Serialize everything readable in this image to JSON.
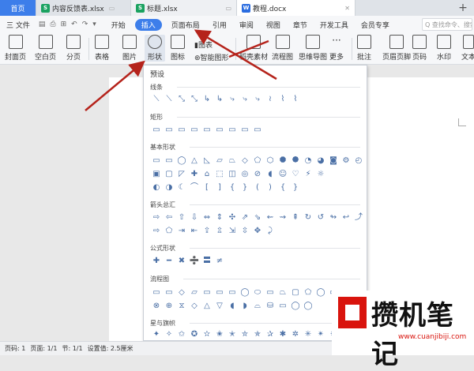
{
  "tabs": [
    {
      "label": "首页",
      "type": "home"
    },
    {
      "label": "内容反馈表.xlsx",
      "icon": "S",
      "icon_color": "#1aa260"
    },
    {
      "label": "标题.xlsx",
      "icon": "S",
      "icon_color": "#1aa260"
    },
    {
      "label": "教程.docx",
      "icon": "W",
      "icon_color": "#2b6de0"
    }
  ],
  "menu": {
    "file": "三 文件",
    "quick": [
      "▤",
      "⎙",
      "⊞",
      "↶",
      "↷",
      "▾"
    ],
    "items": [
      "开始",
      "插入",
      "页面布局",
      "引用",
      "审阅",
      "视图",
      "章节",
      "开发工具",
      "会员专享"
    ],
    "active": "插入",
    "search": "Q 查找命令、搜索"
  },
  "toolbar": {
    "cover": "封面页",
    "blank": "空白页",
    "pagebreak": "分页",
    "table": "表格",
    "picture": "图片",
    "shape": "形状",
    "icon": "图标",
    "chart": "图表",
    "smartart": "智能图形",
    "stock": "稻壳素材",
    "flowchart": "流程图",
    "mindmap": "思维导图",
    "more": "更多",
    "comment": "批注",
    "headerfooter": "页眉页脚",
    "pagenum": "页码",
    "watermark": "水印",
    "text": "文本"
  },
  "shapes_panel": {
    "title": "预设",
    "sections": [
      "线条",
      "矩形",
      "基本形状",
      "箭头总汇",
      "公式形状",
      "流程图",
      "星与旗帜"
    ],
    "lines": [
      "⟍",
      "⟍",
      "⤡",
      "⤡",
      "↳",
      "↳",
      "⤷",
      "⤷",
      "⤷",
      "≀",
      "⌇",
      "⌇"
    ],
    "rects": [
      "▭",
      "▭",
      "▭",
      "▭",
      "▭",
      "▭",
      "▭",
      "▭",
      "▭"
    ],
    "basic1": [
      "▭",
      "▭",
      "◯",
      "△",
      "◺",
      "▱",
      "⏢",
      "◇",
      "⬠",
      "⬡",
      "⯃",
      "⯄",
      "◔",
      "◕",
      "◙",
      "⚙",
      "◴"
    ],
    "basic2": [
      "▣",
      "▢",
      "◸",
      "✚",
      "⌂",
      "⬚",
      "◫",
      "◎",
      "⊘",
      "◖",
      "☺",
      "♡",
      "⚡",
      "☼"
    ],
    "basic3": [
      "◐",
      "◑",
      "☾",
      "⌒",
      "[",
      "]",
      "{",
      "}",
      "(",
      ")",
      "{",
      "}"
    ],
    "arrows1": [
      "⇨",
      "⇦",
      "⇧",
      "⇩",
      "⇔",
      "⇕",
      "✣",
      "⇗",
      "⇘",
      "⇜",
      "⇝",
      "⇞",
      "↻",
      "↺",
      "↬",
      "↩",
      "⤴"
    ],
    "arrows2": [
      "⇨",
      "⬠",
      "⇥",
      "⇤",
      "⇪",
      "⇫",
      "⇲",
      "⇳",
      "✥",
      "⤸"
    ],
    "equation": [
      "✚",
      "━",
      "✖",
      "➗",
      "〓",
      "≠"
    ],
    "flow1": [
      "▭",
      "▭",
      "◇",
      "▱",
      "▭",
      "▭",
      "▭",
      "◯",
      "⬭",
      "▭",
      "⏢",
      "▢",
      "⬠",
      "◯",
      "▭",
      "▱"
    ],
    "flow2": [
      "⊗",
      "⊕",
      "⧖",
      "◇",
      "△",
      "▽",
      "◖",
      "◗",
      "⌓",
      "⛁",
      "▭",
      "◯",
      "◯"
    ],
    "stars1": [
      "✦",
      "✧",
      "✩",
      "✪",
      "✫",
      "✬",
      "✭",
      "✮",
      "✯",
      "✰",
      "✱",
      "✲",
      "✳",
      "✴",
      "✵",
      "✶",
      "✷"
    ],
    "stars2": [
      "⚑",
      "⚐",
      "▭"
    ]
  },
  "status": [
    "页码: 1",
    "页面: 1/1",
    "节: 1/1",
    "设置值: 2.5厘米"
  ],
  "watermark": {
    "text": "攒机笔记",
    "url": "www.cuanjibiji.com",
    "accent": "#d9140d"
  }
}
